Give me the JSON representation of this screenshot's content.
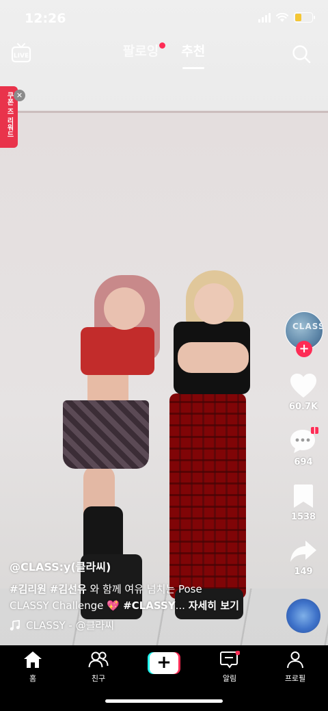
{
  "status_bar": {
    "time": "12:26"
  },
  "top_nav": {
    "live_label": "LIVE",
    "tabs": [
      {
        "label": "팔로잉",
        "has_dot": true,
        "active": false
      },
      {
        "label": "추천",
        "active": true
      }
    ]
  },
  "promo": {
    "text": "쿠폰 즈 리워드"
  },
  "creator": {
    "avatar_text": "CLASS:y"
  },
  "actions": {
    "likes": "60.7K",
    "comments": "694",
    "saves": "1538",
    "shares": "149"
  },
  "caption": {
    "username": "@CLASS:y(클라씨)",
    "hashtag1": "#김리원",
    "hashtag2": "#김선유",
    "text1": " 와 함께 여유 넘치는 Pose",
    "text2": "CLASSY Challenge ",
    "emoji": "💖",
    "hashtag3": " #CLASSY",
    "ellipsis": "... ",
    "more": "자세히 보기"
  },
  "music": {
    "title": "CLASSY - @클라씨"
  },
  "bottom_nav": [
    {
      "label": "홈"
    },
    {
      "label": "친구"
    },
    {
      "label": ""
    },
    {
      "label": "알림"
    },
    {
      "label": "프로필"
    }
  ],
  "colors": {
    "accent": "#fe2c55",
    "cyan": "#25f4ee"
  }
}
